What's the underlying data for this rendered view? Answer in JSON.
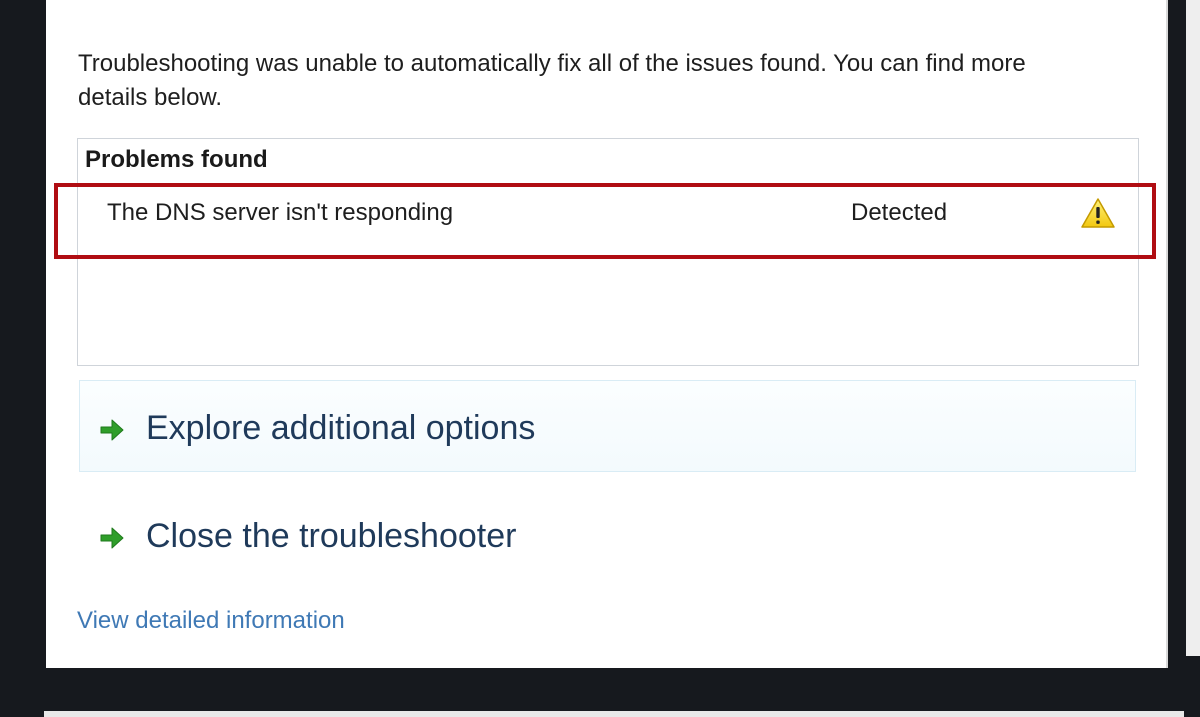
{
  "intro_text": "Troubleshooting was unable to automatically fix all of the issues found. You can find more details below.",
  "problems": {
    "header": "Problems found",
    "items": [
      {
        "name": "The DNS server isn't responding",
        "status": "Detected",
        "icon": "warning-icon"
      }
    ]
  },
  "options": {
    "explore": {
      "label": "Explore additional options",
      "icon": "green-arrow-icon"
    },
    "close": {
      "label": "Close the troubleshooter",
      "icon": "green-arrow-icon"
    }
  },
  "detail_link": "View detailed information",
  "colors": {
    "highlight": "#b00d12",
    "link": "#3f79b5",
    "option_text": "#1f3a5a",
    "arrow": "#2f9e2a",
    "warning": "#f2c811"
  }
}
